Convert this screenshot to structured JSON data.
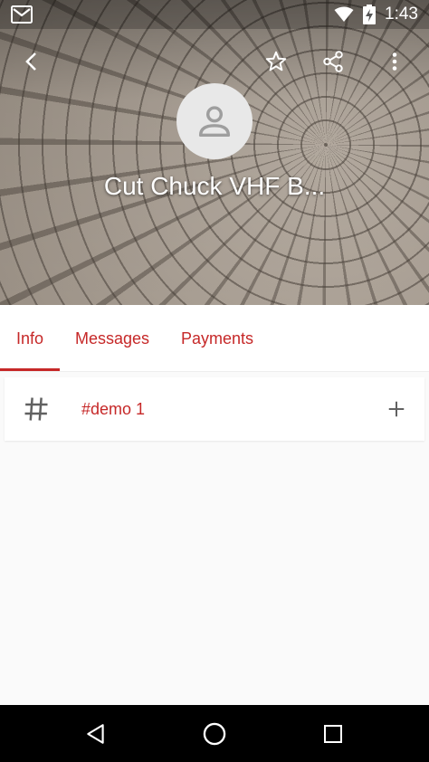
{
  "status_bar": {
    "time": "1:43",
    "icons": [
      "gmail-icon",
      "wifi-icon",
      "battery-charging-icon"
    ]
  },
  "app_bar": {
    "icons": [
      "back-icon",
      "star-icon",
      "share-icon",
      "more-vert-icon"
    ]
  },
  "contact": {
    "name": "Cut Chuck VHF B...",
    "avatar_icon": "person-icon"
  },
  "tabs": [
    {
      "label": "Info",
      "selected": true
    },
    {
      "label": "Messages",
      "selected": false
    },
    {
      "label": "Payments",
      "selected": false
    }
  ],
  "channels": [
    {
      "icon": "hash-icon",
      "name": "#demo 1",
      "action_icon": "add-icon"
    }
  ],
  "nav_bar": {
    "icons": [
      "back-triangle-icon",
      "home-circle-icon",
      "recents-square-icon"
    ]
  },
  "colors": {
    "accent": "#c62828",
    "nav_bar": "#000000",
    "background": "#fafafa"
  }
}
